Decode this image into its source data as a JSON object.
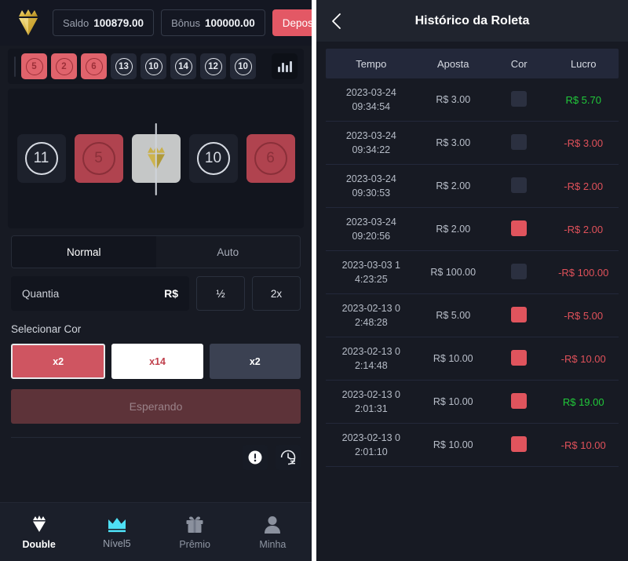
{
  "left": {
    "header": {
      "logo_icon": "crown-diamond-logo",
      "balance_label": "Saldo",
      "balance_value": "100879.00",
      "bonus_label": "Bônus",
      "bonus_value": "100000.00",
      "deposit_label": "Depositar"
    },
    "recent": {
      "items": [
        {
          "num": "5",
          "color": "red"
        },
        {
          "num": "2",
          "color": "red"
        },
        {
          "num": "6",
          "color": "red"
        },
        {
          "num": "13",
          "color": "black"
        },
        {
          "num": "10",
          "color": "black"
        },
        {
          "num": "14",
          "color": "black"
        },
        {
          "num": "12",
          "color": "black"
        },
        {
          "num": "10",
          "color": "black"
        }
      ],
      "stats_icon": "bar-chart-icon"
    },
    "wheel": {
      "tiles": [
        {
          "num": "11",
          "color": "black"
        },
        {
          "num": "5",
          "color": "red"
        },
        {
          "num": "",
          "color": "white",
          "icon": "crown-diamond-icon"
        },
        {
          "num": "10",
          "color": "black"
        },
        {
          "num": "6",
          "color": "red"
        }
      ]
    },
    "modes": [
      {
        "label": "Normal",
        "active": true
      },
      {
        "label": "Auto",
        "active": false
      }
    ],
    "amount": {
      "placeholder": "Quantia",
      "value": "",
      "currency": "R$",
      "half_label": "½",
      "double_label": "2x"
    },
    "select_color": {
      "title": "Selecionar Cor",
      "options": [
        {
          "label": "x2",
          "kind": "red",
          "selected": true
        },
        {
          "label": "x14",
          "kind": "white",
          "selected": false
        },
        {
          "label": "x2",
          "kind": "black",
          "selected": false
        }
      ]
    },
    "action": {
      "label": "Esperando"
    },
    "tools": [
      {
        "icon": "info-circle-icon"
      },
      {
        "icon": "history-clock-icon"
      }
    ],
    "nav": [
      {
        "label": "Double",
        "icon": "crown-diamond-icon",
        "active": true
      },
      {
        "label": "Nível5",
        "icon": "crown-icon",
        "active": false
      },
      {
        "label": "Prêmio",
        "icon": "gift-icon",
        "active": false
      },
      {
        "label": "Minha",
        "icon": "user-icon",
        "active": false
      }
    ]
  },
  "right": {
    "back_icon": "chevron-left-icon",
    "title": "Histórico da Roleta",
    "columns": [
      "Tempo",
      "Aposta",
      "Cor",
      "Lucro"
    ],
    "rows": [
      {
        "date": "2023-03-24",
        "time": "09:34:54",
        "bet": "R$ 3.00",
        "color": "black",
        "profit": "R$ 5.70",
        "sign": "pos"
      },
      {
        "date": "2023-03-24",
        "time": "09:34:22",
        "bet": "R$ 3.00",
        "color": "black",
        "profit": "-R$ 3.00",
        "sign": "neg"
      },
      {
        "date": "2023-03-24",
        "time": "09:30:53",
        "bet": "R$ 2.00",
        "color": "black",
        "profit": "-R$ 2.00",
        "sign": "neg"
      },
      {
        "date": "2023-03-24",
        "time": "09:20:56",
        "bet": "R$ 2.00",
        "color": "red",
        "profit": "-R$ 2.00",
        "sign": "neg"
      },
      {
        "date": "2023-03-03 1",
        "time": "4:23:25",
        "bet": "R$ 100.00",
        "color": "black",
        "profit": "-R$ 100.00",
        "sign": "neg"
      },
      {
        "date": "2023-02-13 0",
        "time": "2:48:28",
        "bet": "R$ 5.00",
        "color": "red",
        "profit": "-R$ 5.00",
        "sign": "neg"
      },
      {
        "date": "2023-02-13 0",
        "time": "2:14:48",
        "bet": "R$ 10.00",
        "color": "red",
        "profit": "-R$ 10.00",
        "sign": "neg"
      },
      {
        "date": "2023-02-13 0",
        "time": "2:01:31",
        "bet": "R$ 10.00",
        "color": "red",
        "profit": "R$ 19.00",
        "sign": "pos"
      },
      {
        "date": "2023-02-13 0",
        "time": "2:01:10",
        "bet": "R$ 10.00",
        "color": "red",
        "profit": "-R$ 10.00",
        "sign": "neg"
      }
    ]
  },
  "colors": {
    "accent_red": "#e35865",
    "profit_green": "#21c93a",
    "loss_red": "#e0515a",
    "level_cyan": "#4ee0f5",
    "gold": "#d8b444",
    "panel_bg": "#171a23"
  }
}
